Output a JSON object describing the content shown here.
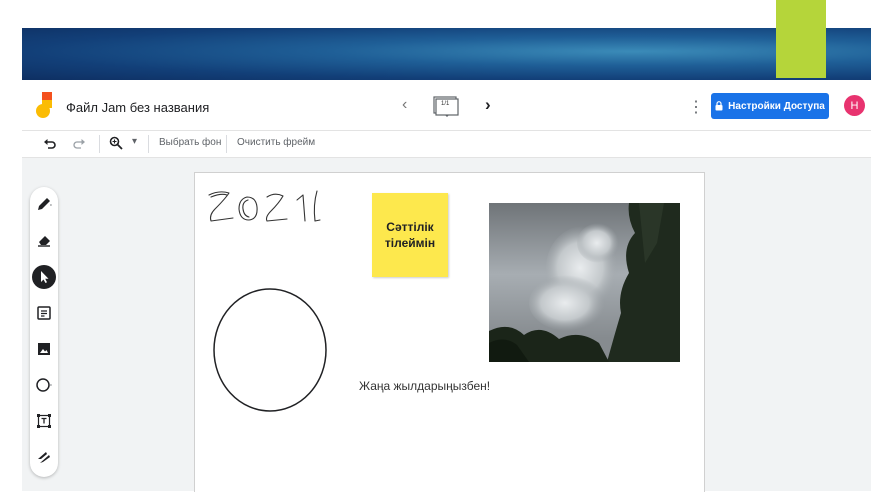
{
  "app": {
    "doc_title": "Файл Jam без названия",
    "frame_indicator": "1/1",
    "share_label": "Настройки Доступа",
    "avatar_initial": "H"
  },
  "toolbar": {
    "set_background_label": "Выбрать фон",
    "clear_frame_label": "Очистить фрейм"
  },
  "canvas": {
    "sticky_text": "Сәттілік\nтілеймін",
    "caption": "Жаңа жылдарыңызбен!"
  },
  "tools": [
    "pen-icon",
    "eraser-icon",
    "select-icon",
    "sticky-note-icon",
    "image-icon",
    "circle-icon",
    "text-box-icon",
    "laser-icon"
  ],
  "colors": {
    "accent": "#1a73e8",
    "sticky": "#fde84d",
    "avatar": "#e8336f",
    "slide_green": "#b5d53a"
  }
}
